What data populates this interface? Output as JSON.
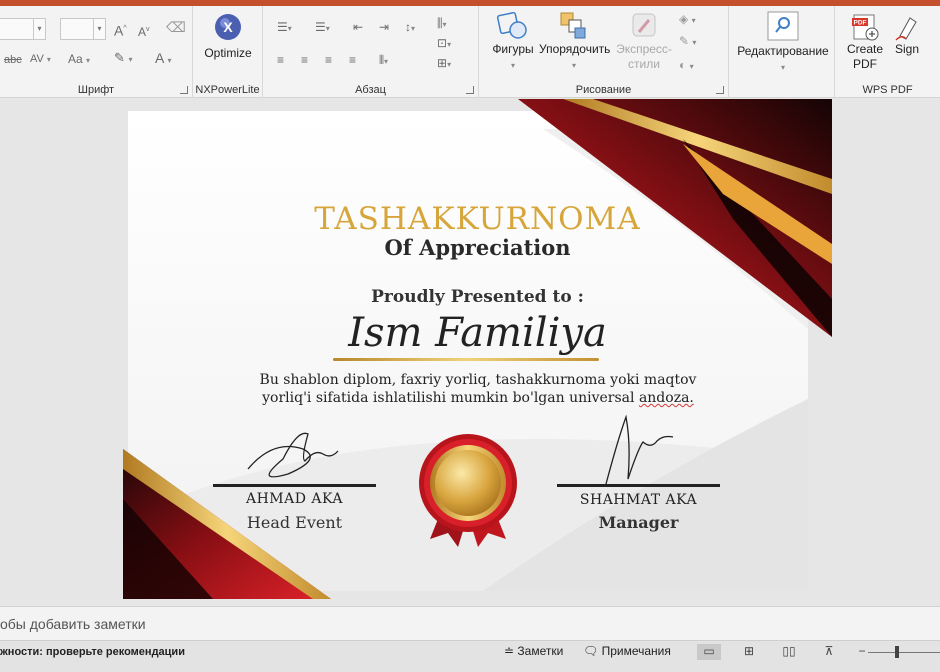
{
  "ribbon": {
    "font_group": {
      "label": "Шрифт"
    },
    "nxpower": {
      "label": "NXPowerLite",
      "button": "Optimize"
    },
    "paragraph_group": {
      "label": "Абзац"
    },
    "drawing_group": {
      "label": "Рисование",
      "shapes": "Фигуры",
      "arrange": "Упорядочить",
      "quick_styles_1": "Экспресс-",
      "quick_styles_2": "стили"
    },
    "editing": {
      "label": "Редактирование"
    },
    "wps": {
      "label": "WPS PDF",
      "create_1": "Create",
      "create_2": "PDF",
      "sign": "Sign",
      "pdf_badge": "PDF"
    }
  },
  "slide": {
    "title": "TASHAKKURNOMA",
    "subtitle": "Of Appreciation",
    "presented": "Proudly Presented to :",
    "recipient": "Ism Familiya",
    "desc_line1": "Bu shablon diplom, faxriy yorliq, tashakkurnoma yoki maqtov",
    "desc_line2_a": "yorliq'i sifatida ishlatilishi mumkin bo'lgan universal ",
    "desc_line2_b": "andoza.",
    "signer1": {
      "name": "AHMAD AKA",
      "role": "Head Event"
    },
    "signer2": {
      "name": "SHAHMAT AKA",
      "role": "Manager"
    }
  },
  "notes": {
    "placeholder": "обы добавить заметки"
  },
  "status": {
    "accessibility": "жности: проверьте рекомендации",
    "notes_btn": "Заметки",
    "comments_btn": "Примечания"
  },
  "colors": {
    "accent": "#c4502d",
    "gold": "#d7a63a",
    "red": "#c8141c"
  }
}
